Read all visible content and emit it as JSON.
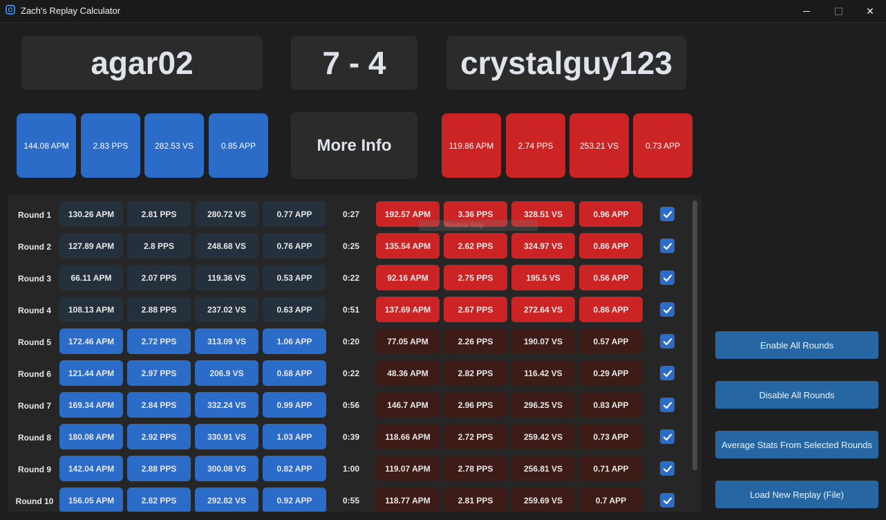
{
  "window": {
    "title": "Zach's Replay Calculator",
    "min_label": "",
    "close_label": "✕"
  },
  "header": {
    "player_left": "agar02",
    "score": "7 - 4",
    "player_right": "crystalguy123",
    "more_info": "More Info"
  },
  "left_stats": [
    "144.08 APM",
    "2.83 PPS",
    "282.53 VS",
    "0.85 APP"
  ],
  "right_stats": [
    "119.86 APM",
    "2.74 PPS",
    "253.21 VS",
    "0.73 APP"
  ],
  "colors": {
    "blue": "#2a6cc8",
    "red": "#cc2424",
    "dark_cell": "#24313d",
    "brown_cell": "#3d1b17",
    "button": "#2566a3"
  },
  "rounds": [
    {
      "label": "Round 1",
      "left": [
        "130.26 APM",
        "2.81 PPS",
        "280.72 VS",
        "0.77 APP"
      ],
      "time": "0:27",
      "right": [
        "192.57 APM",
        "3.36 PPS",
        "328.51 VS",
        "0.96 APP"
      ],
      "winner": "right",
      "checked": true
    },
    {
      "label": "Round 2",
      "left": [
        "127.89 APM",
        "2.8 PPS",
        "248.68 VS",
        "0.76 APP"
      ],
      "time": "0:25",
      "right": [
        "135.54 APM",
        "2.62 PPS",
        "324.97 VS",
        "0.86 APP"
      ],
      "winner": "right",
      "checked": true
    },
    {
      "label": "Round 3",
      "left": [
        "66.11 APM",
        "2.07 PPS",
        "119.36 VS",
        "0.53 APP"
      ],
      "time": "0:22",
      "right": [
        "92.16 APM",
        "2.75 PPS",
        "195.5 VS",
        "0.56 APP"
      ],
      "winner": "right",
      "checked": true
    },
    {
      "label": "Round 4",
      "left": [
        "108.13 APM",
        "2.88 PPS",
        "237.02 VS",
        "0.63 APP"
      ],
      "time": "0:51",
      "right": [
        "137.69 APM",
        "2.67 PPS",
        "272.64 VS",
        "0.86 APP"
      ],
      "winner": "right",
      "checked": true
    },
    {
      "label": "Round 5",
      "left": [
        "172.46 APM",
        "2.72 PPS",
        "313.09 VS",
        "1.06 APP"
      ],
      "time": "0:20",
      "right": [
        "77.05 APM",
        "2.26 PPS",
        "190.07 VS",
        "0.57 APP"
      ],
      "winner": "left",
      "checked": true
    },
    {
      "label": "Round 6",
      "left": [
        "121.44 APM",
        "2.97 PPS",
        "206.9 VS",
        "0.68 APP"
      ],
      "time": "0:22",
      "right": [
        "48.36 APM",
        "2.82 PPS",
        "116.42 VS",
        "0.29 APP"
      ],
      "winner": "left",
      "checked": true
    },
    {
      "label": "Round 7",
      "left": [
        "169.34 APM",
        "2.84 PPS",
        "332.24 VS",
        "0.99 APP"
      ],
      "time": "0:56",
      "right": [
        "146.7 APM",
        "2.96 PPS",
        "296.25 VS",
        "0.83 APP"
      ],
      "winner": "left",
      "checked": true
    },
    {
      "label": "Round 8",
      "left": [
        "180.08 APM",
        "2.92 PPS",
        "330.91 VS",
        "1.03 APP"
      ],
      "time": "0:39",
      "right": [
        "118.66 APM",
        "2.72 PPS",
        "259.42 VS",
        "0.73 APP"
      ],
      "winner": "left",
      "checked": true
    },
    {
      "label": "Round 9",
      "left": [
        "142.04 APM",
        "2.88 PPS",
        "300.08 VS",
        "0.82 APP"
      ],
      "time": "1:00",
      "right": [
        "119.07 APM",
        "2.78 PPS",
        "256.81 VS",
        "0.71 APP"
      ],
      "winner": "left",
      "checked": true
    },
    {
      "label": "Round 10",
      "left": [
        "156.05 APM",
        "2.82 PPS",
        "292.82 VS",
        "0.92 APP"
      ],
      "time": "0:55",
      "right": [
        "118.77 APM",
        "2.81 PPS",
        "259.69 VS",
        "0.7 APP"
      ],
      "winner": "left",
      "checked": true
    }
  ],
  "watermark": "Window Snip",
  "buttons": {
    "enable_all": "Enable All Rounds",
    "disable_all": "Disable All Rounds",
    "average": "Average Stats From Selected Rounds",
    "load": "Load New Replay (File)"
  }
}
